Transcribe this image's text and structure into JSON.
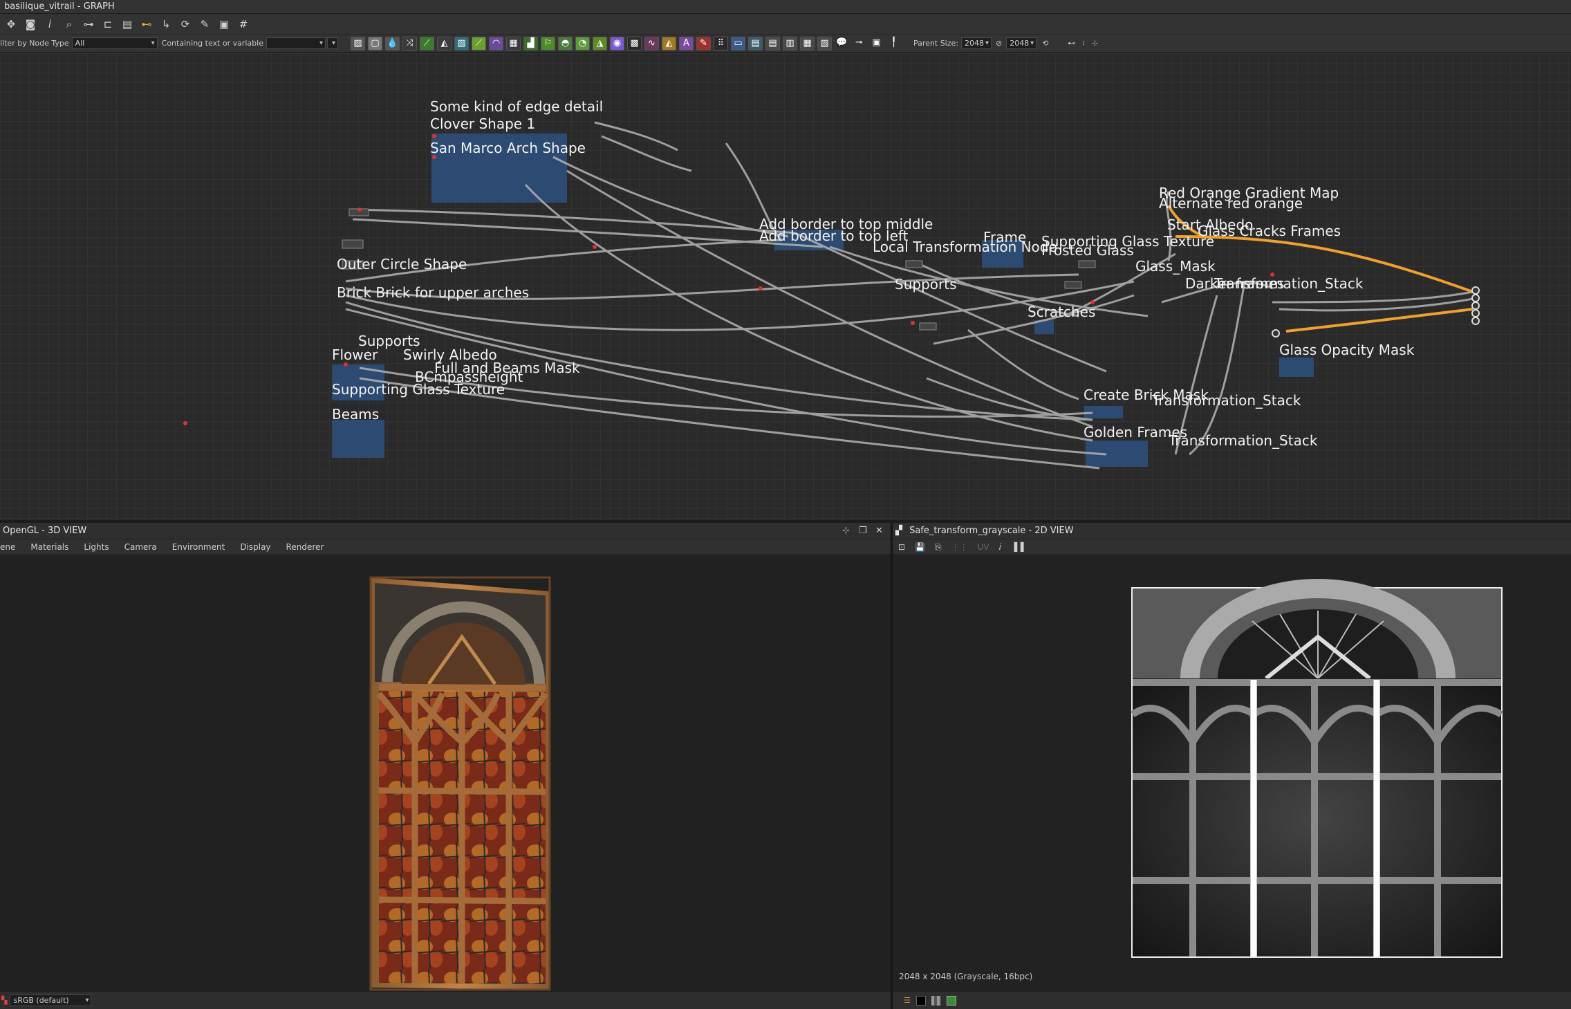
{
  "window": {
    "title": "basilique_vitrail - GRAPH"
  },
  "toolbar": {
    "icons": [
      "move-icon",
      "camera-icon",
      "info-icon",
      "search-icon",
      "align-icon",
      "hierarchy-icon",
      "table-icon",
      "link-icon",
      "reroute-icon",
      "refresh-icon",
      "wrench-icon",
      "frame-icon",
      "grid-icon"
    ]
  },
  "filter": {
    "node_type_label": "ilter by Node Type",
    "node_type_value": "All",
    "containing_label": "Containing text or variable",
    "containing_value": ""
  },
  "parent_size": {
    "label": "Parent Size:",
    "width": "2048",
    "height": "2048"
  },
  "graph": {
    "frames": [
      "Some kind of edge detail",
      "Clover Shape 1",
      "San Marco Arch Shape",
      "Outer Circle Shape",
      "Brick Brick for upper arches",
      "Supports",
      "Flower",
      "Swirly Albedo",
      "Full and Beams Mask",
      "BCmpassheight",
      "Supporting Glass Texture",
      "Beams",
      "Add border to top middle",
      "Add border to top left",
      "Local Transformation Node",
      "Frame",
      "Supporting Glass Texture",
      "Frosted Glass",
      "Supports",
      "Scratches",
      "Glass_Mask",
      "Red Orange Gradient Map",
      "Alternate red orange",
      "Start Albedo",
      "Glass Cracks Frames",
      "Darker frames",
      "Transformation_Stack",
      "Glass Opacity Mask",
      "Create Brick Mask",
      "Transformation_Stack",
      "Golden Frames",
      "Transformation_Stack"
    ]
  },
  "view3d": {
    "title": "OpenGL - 3D VIEW",
    "menu": [
      "ene",
      "Materials",
      "Lights",
      "Camera",
      "Environment",
      "Display",
      "Renderer"
    ],
    "colorspace": "sRGB (default)"
  },
  "view2d": {
    "title": "Safe_transform_grayscale - 2D VIEW",
    "image_info": "2048 x 2048 (Grayscale, 16bpc)",
    "uv_label": "UV"
  },
  "colors": {
    "accent_orange": "#f0a030",
    "frame_blue": "#2e4f7a",
    "wire": "#b4b4b4"
  }
}
